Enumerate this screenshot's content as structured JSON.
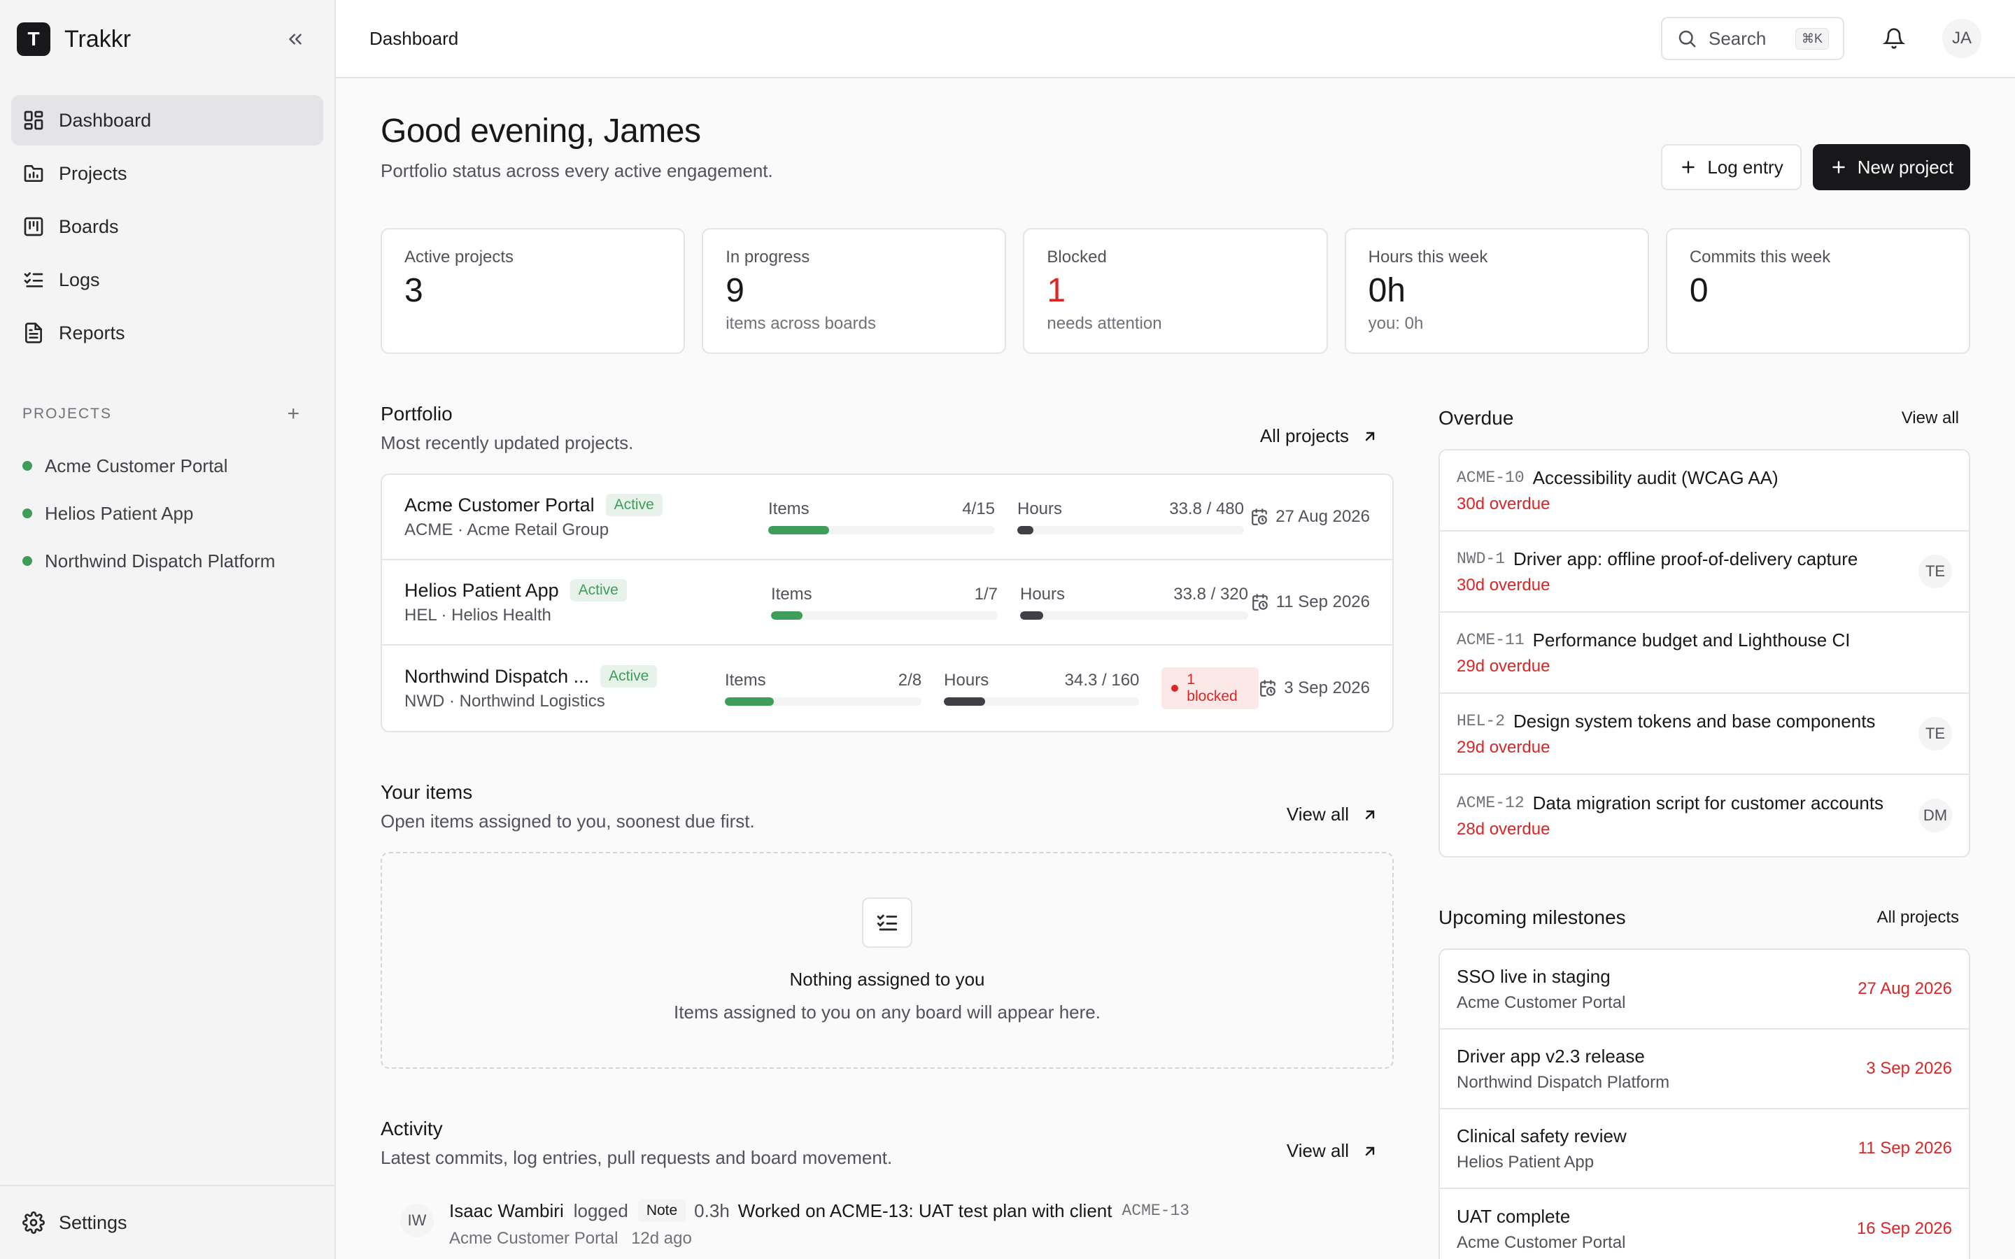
{
  "app": {
    "logo_letter": "T",
    "name": "Trakkr"
  },
  "sidebar": {
    "nav": [
      {
        "label": "Dashboard",
        "icon": "dashboard-icon",
        "active": true
      },
      {
        "label": "Projects",
        "icon": "folder-chart-icon"
      },
      {
        "label": "Boards",
        "icon": "kanban-icon"
      },
      {
        "label": "Logs",
        "icon": "list-checks-icon"
      },
      {
        "label": "Reports",
        "icon": "file-text-icon"
      }
    ],
    "projects_heading": "PROJECTS",
    "projects": [
      "Acme Customer Portal",
      "Helios Patient App",
      "Northwind Dispatch Platform"
    ],
    "settings_label": "Settings"
  },
  "topbar": {
    "breadcrumb": "Dashboard",
    "search_label": "Search",
    "search_shortcut": "⌘K",
    "avatar_initials": "JA"
  },
  "header": {
    "greeting": "Good evening, James",
    "subtitle": "Portfolio status across every active engagement.",
    "log_entry_label": "Log entry",
    "new_project_label": "New project"
  },
  "stats": [
    {
      "label": "Active projects",
      "value": "3",
      "sub": ""
    },
    {
      "label": "In progress",
      "value": "9",
      "sub": "items across boards"
    },
    {
      "label": "Blocked",
      "value": "1",
      "sub": "needs attention",
      "alert": true
    },
    {
      "label": "Hours this week",
      "value": "0h",
      "sub": "you: 0h"
    },
    {
      "label": "Commits this week",
      "value": "0",
      "sub": ""
    }
  ],
  "portfolio": {
    "title": "Portfolio",
    "subtitle": "Most recently updated projects.",
    "link": "All projects",
    "items_label": "Items",
    "hours_label": "Hours",
    "rows": [
      {
        "name": "Acme Customer Portal",
        "status": "Active",
        "meta": "ACME · Acme Retail Group",
        "items": "4/15",
        "items_frac": 0.27,
        "hours": "33.8 / 480",
        "hours_frac": 0.07,
        "blocked": "",
        "date": "27 Aug 2026"
      },
      {
        "name": "Helios Patient App",
        "status": "Active",
        "meta": "HEL · Helios Health",
        "items": "1/7",
        "items_frac": 0.14,
        "hours": "33.8 / 320",
        "hours_frac": 0.1,
        "blocked": "",
        "date": "11 Sep 2026"
      },
      {
        "name": "Northwind Dispatch ...",
        "status": "Active",
        "meta": "NWD · Northwind Logistics",
        "items": "2/8",
        "items_frac": 0.25,
        "hours": "34.3 / 160",
        "hours_frac": 0.21,
        "blocked": "1 blocked",
        "date": "3 Sep 2026"
      }
    ]
  },
  "your_items": {
    "title": "Your items",
    "subtitle": "Open items assigned to you, soonest due first.",
    "link": "View all",
    "empty_title": "Nothing assigned to you",
    "empty_sub": "Items assigned to you on any board will appear here."
  },
  "activity": {
    "title": "Activity",
    "subtitle": "Latest commits, log entries, pull requests and board movement.",
    "link": "View all",
    "entries": [
      {
        "initials": "IW",
        "user": "Isaac Wambiri",
        "verb": "logged",
        "tag": "Note",
        "hours": "0.3h",
        "text": "Worked on ACME-13: UAT test plan with client",
        "key": "ACME-13",
        "project": "Acme Customer Portal",
        "ago": "12d ago"
      }
    ]
  },
  "overdue": {
    "title": "Overdue",
    "link": "View all",
    "items": [
      {
        "key": "ACME-10",
        "title": "Accessibility audit (WCAG AA)",
        "due": "30d overdue",
        "assignee": ""
      },
      {
        "key": "NWD-1",
        "title": "Driver app: offline proof-of-delivery capture",
        "due": "30d overdue",
        "assignee": "TE"
      },
      {
        "key": "ACME-11",
        "title": "Performance budget and Lighthouse CI",
        "due": "29d overdue",
        "assignee": ""
      },
      {
        "key": "HEL-2",
        "title": "Design system tokens and base components",
        "due": "29d overdue",
        "assignee": "TE"
      },
      {
        "key": "ACME-12",
        "title": "Data migration script for customer accounts",
        "due": "28d overdue",
        "assignee": "DM"
      }
    ]
  },
  "milestones": {
    "title": "Upcoming milestones",
    "link": "All projects",
    "items": [
      {
        "title": "SSO live in staging",
        "project": "Acme Customer Portal",
        "date": "27 Aug 2026"
      },
      {
        "title": "Driver app v2.3 release",
        "project": "Northwind Dispatch Platform",
        "date": "3 Sep 2026"
      },
      {
        "title": "Clinical safety review",
        "project": "Helios Patient App",
        "date": "11 Sep 2026"
      },
      {
        "title": "UAT complete",
        "project": "Acme Customer Portal",
        "date": "16 Sep 2026"
      }
    ]
  },
  "colors": {
    "accent_green": "#3f9d5a",
    "danger": "#dc2626",
    "bar_dark": "#3f3f46"
  }
}
